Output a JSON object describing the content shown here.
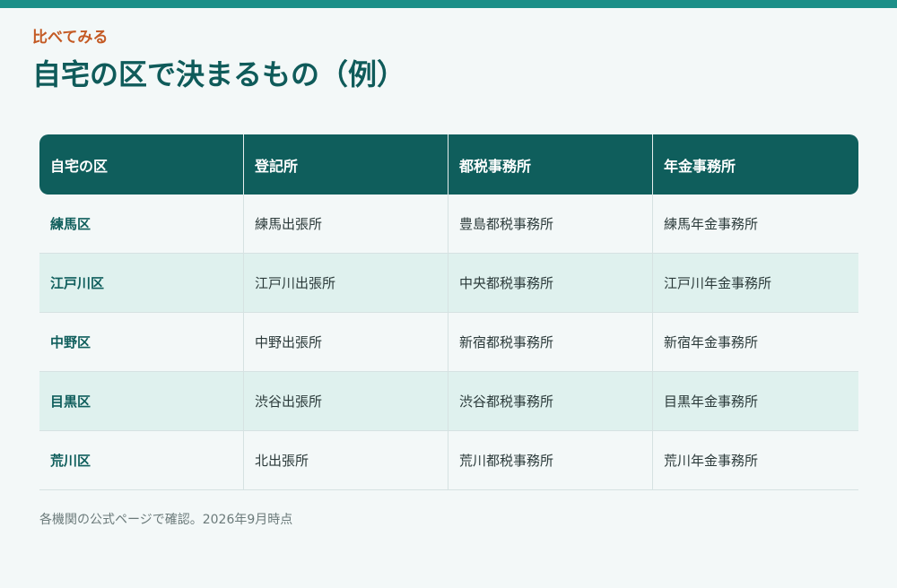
{
  "eyebrow": "比べてみる",
  "title": "自宅の区で決まるもの（例）",
  "table": {
    "headers": [
      "自宅の区",
      "登記所",
      "都税事務所",
      "年金事務所"
    ],
    "rows": [
      [
        "練馬区",
        "練馬出張所",
        "豊島都税事務所",
        "練馬年金事務所"
      ],
      [
        "江戸川区",
        "江戸川出張所",
        "中央都税事務所",
        "江戸川年金事務所"
      ],
      [
        "中野区",
        "中野出張所",
        "新宿都税事務所",
        "新宿年金事務所"
      ],
      [
        "目黒区",
        "渋谷出張所",
        "渋谷都税事務所",
        "目黒年金事務所"
      ],
      [
        "荒川区",
        "北出張所",
        "荒川都税事務所",
        "荒川年金事務所"
      ]
    ]
  },
  "footnote": "各機関の公式ページで確認。2026年9月時点",
  "colors": {
    "accent_bar": "#1b8f88",
    "eyebrow": "#c45a24",
    "title": "#0f5b5a",
    "header_bg": "#0f5e5c",
    "row_alt_bg": "#dff1ee",
    "page_bg": "#f3f8f8"
  }
}
